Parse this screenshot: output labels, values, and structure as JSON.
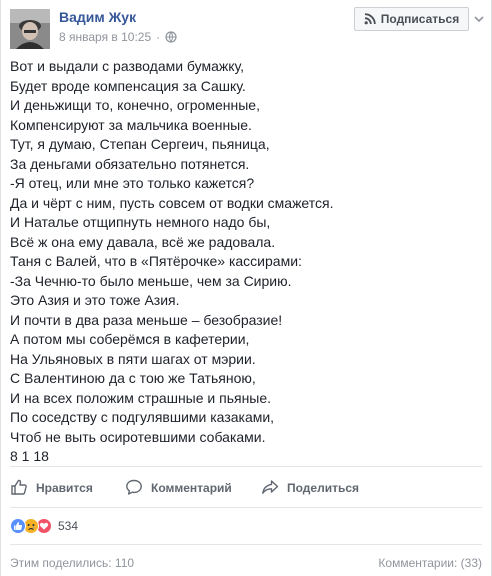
{
  "post": {
    "author": "Вадим Жук",
    "date": "8 января в 10:25",
    "subscribe_label": "Подписаться",
    "lines": [
      "Вот и выдали с разводами бумажку,",
      "Будет вроде компенсация за Сашку.",
      "И деньжищи то, конечно, огроменные,",
      "Компенсируют за мальчика военные.",
      "Тут, я думаю, Степан Сергеич, пьяница,",
      "За деньгами обязательно потянется.",
      "-Я отец, или мне это только кажется?",
      "Да и чёрт с ним, пусть совсем от водки смажется.",
      "И Наталье отщипнуть немного надо бы,",
      "Всё ж она ему давала, всё же радовала.",
      "Таня с Валей, что в «Пятёрочке» кассирами:",
      "-За Чечню-то было меньше, чем за Сирию.",
      "Это Азия и это тоже Азия.",
      "И почти в два раза меньше – безобразие!",
      "А потом мы соберёмся в кафетерии,",
      "На Ульяновых в пяти шагах от мэрии.",
      "С Валентиною да с тою же Татьяною,",
      "И на всех положим страшные и пьяные.",
      "По соседству с подгулявшими казаками,",
      "Чтоб не выть осиротевшими собаками.",
      "8 1 18"
    ]
  },
  "actions": {
    "like": "Нравится",
    "comment": "Комментарий",
    "share": "Поделиться"
  },
  "reactions": {
    "count": "534",
    "icons": [
      "like-icon",
      "sad-icon",
      "love-icon"
    ],
    "colors": {
      "like": "#5890ff",
      "sad": "#f7b125",
      "love": "#f25268"
    }
  },
  "footer": {
    "shares": "Этим поделились: 110",
    "comments": "Комментарии: (33)"
  },
  "colors": {
    "link": "#365899",
    "text": "#1d2129",
    "muted": "#90949c",
    "action": "#606770"
  }
}
